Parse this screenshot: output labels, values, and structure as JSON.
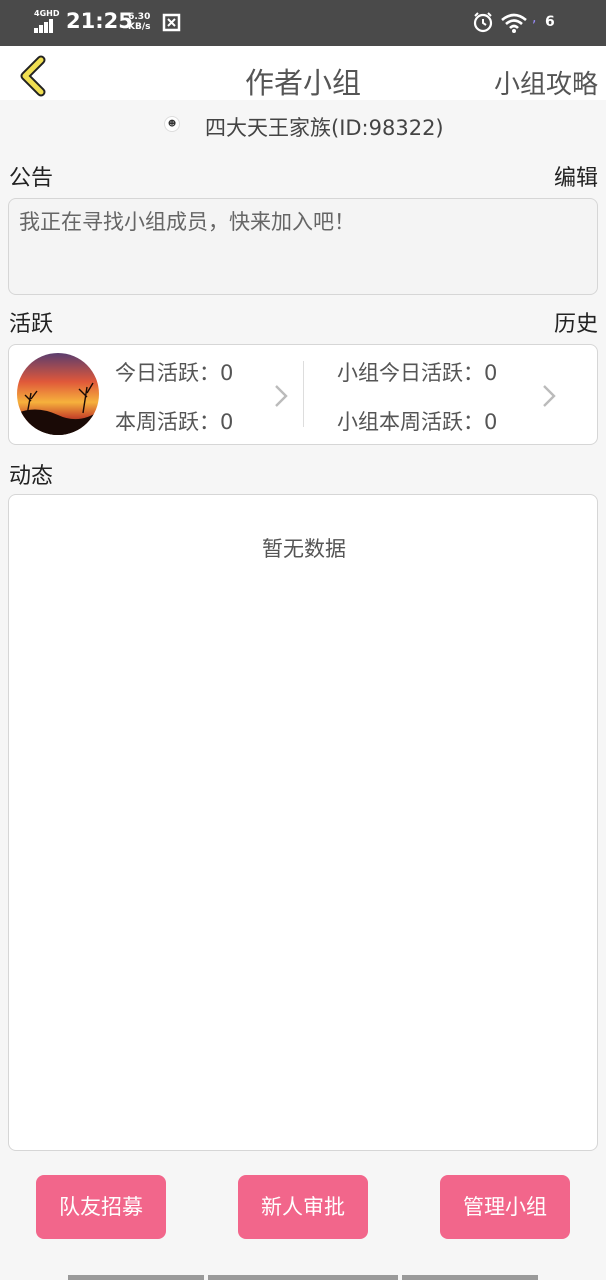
{
  "status_bar": {
    "network": "4GHD",
    "time": "21:25",
    "speed_value": "6.30",
    "speed_unit": "KB/s",
    "battery": "6"
  },
  "header": {
    "title": "作者小组",
    "strategy_link": "小组攻略"
  },
  "group": {
    "name": "四大天王家族(ID:98322)"
  },
  "notice": {
    "label": "公告",
    "edit_label": "编辑",
    "text": "我正在寻找小组成员，快来加入吧！"
  },
  "activity": {
    "label": "活跃",
    "history_label": "历史",
    "today": "今日活跃：0",
    "week": "本周活跃：0",
    "group_today": "小组今日活跃：0",
    "group_week": "小组本周活跃：0"
  },
  "feed": {
    "label": "动态",
    "empty_text": "暂无数据"
  },
  "actions": {
    "recruit": "队友招募",
    "approve": "新人审批",
    "manage": "管理小组"
  },
  "colors": {
    "accent_pink": "#f2668b",
    "back_arrow": "#f0df52"
  }
}
